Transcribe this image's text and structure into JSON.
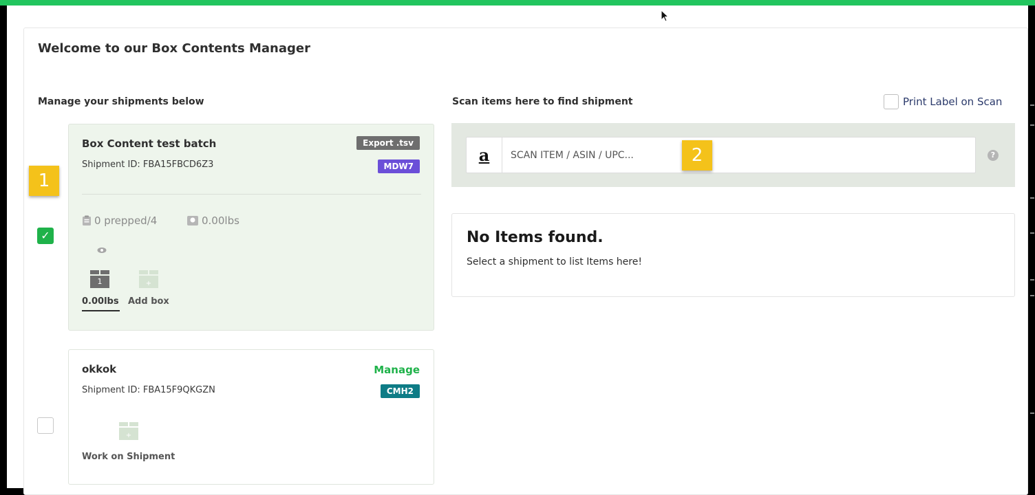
{
  "header": {
    "title": "Welcome to our Box Contents Manager"
  },
  "left": {
    "section_label": "Manage your shipments below",
    "shipments": [
      {
        "name": "Box Content test batch",
        "shipment_id_text": "Shipment ID: FBA15FBCD6Z3",
        "action_label": "Export .tsv",
        "tag": "MDW7",
        "tag_color": "#6b4fd8",
        "prepped_text": "0 prepped/4",
        "weight_text": "0.00lbs",
        "box_number": "1",
        "box_weight_label": "0.00lbs",
        "add_box_label": "Add box",
        "selected": true
      },
      {
        "name": "okkok",
        "shipment_id_text": "Shipment ID: FBA15F9QKGZN",
        "action_label": "Manage",
        "tag": "CMH2",
        "tag_color": "#0e7c86",
        "work_label": "Work on Shipment",
        "selected": false
      }
    ]
  },
  "right": {
    "section_label": "Scan items here to find shipment",
    "print_label_text": "Print Label on Scan",
    "scan": {
      "placeholder": "SCAN ITEM / ASIN / UPC...",
      "amazon_glyph": "a"
    },
    "help_glyph": "?",
    "results": {
      "title": "No Items found.",
      "subtitle": "Select a shipment to list Items here!"
    }
  },
  "markers": {
    "one": "1",
    "two": "2"
  },
  "colors": {
    "accent_green": "#1fb24a",
    "top_bar": "#22c55e",
    "marker_yellow": "#f4c21a"
  }
}
